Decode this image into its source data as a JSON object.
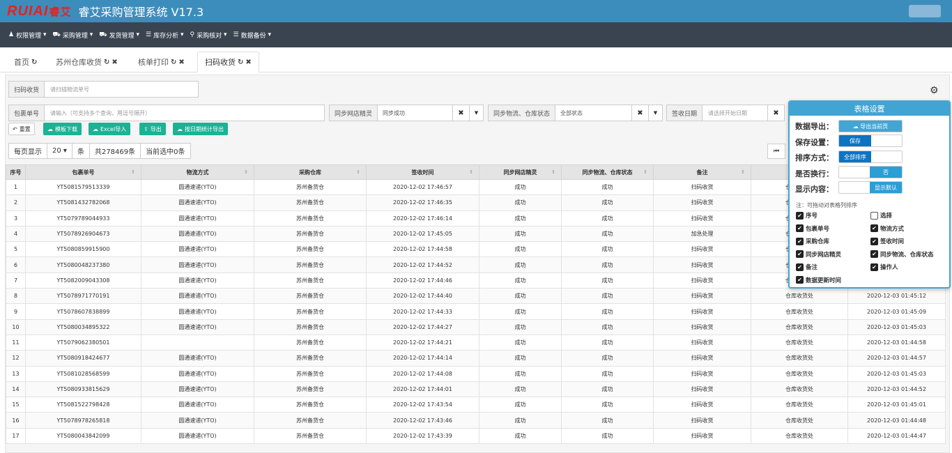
{
  "app": {
    "logo_text": "RUIAI",
    "logo_cn": "睿艾",
    "title": "睿艾采购管理系统 V17.3"
  },
  "menu": [
    {
      "icon": "user-icon",
      "glyph": "♟",
      "label": "权限管理"
    },
    {
      "icon": "cart-icon",
      "glyph": "⛟",
      "label": "采购管理"
    },
    {
      "icon": "truck-icon",
      "glyph": "⛟",
      "label": "发货管理"
    },
    {
      "icon": "list-icon",
      "glyph": "☰",
      "label": "库存分析"
    },
    {
      "icon": "search-icon",
      "glyph": "⚲",
      "label": "采购核对"
    },
    {
      "icon": "database-icon",
      "glyph": "☰",
      "label": "数据备份"
    }
  ],
  "tabs": [
    {
      "label": "首页"
    },
    {
      "label": "苏州仓库收货"
    },
    {
      "label": "核单打印"
    },
    {
      "label": "扫码收货"
    }
  ],
  "scan": {
    "label": "扫码收货",
    "placeholder": "请扫描物流单号"
  },
  "filters": {
    "package_label": "包裹单号",
    "package_placeholder": "请输入（可支持多个查询，用逗号隔开）",
    "sync_shop_label": "同步网店精灵",
    "sync_shop_value": "同步成功",
    "sync_status_label": "同步物流、仓库状态",
    "sync_status_value": "全部状态",
    "date_label": "签收日期",
    "date_placeholder": "请选择开始日期"
  },
  "toolbar": {
    "reset": "重置",
    "template_download": "模板下载",
    "excel_import": "Excel导入",
    "export": "导出",
    "export_by_date": "按日期统计导出"
  },
  "pagination": {
    "per_page_label": "每页显示",
    "per_page_value": "20",
    "unit": "条",
    "total": "共278469条",
    "selected": "当前选中0条"
  },
  "table": {
    "columns": [
      "序号",
      "包裹单号",
      "物流方式",
      "采购仓库",
      "签收时间",
      "同步网店精灵",
      "同步物流、仓库状态",
      "备注",
      "操作人",
      "数据更新时间"
    ],
    "rows": [
      [
        "1",
        "YT5081579513339",
        "圆通速递(YTO)",
        "苏州备货仓",
        "2020-12-02 17:46:57",
        "成功",
        "成功",
        "扫码收货",
        "仓库收货处",
        ""
      ],
      [
        "2",
        "YT5081432782068",
        "圆通速递(YTO)",
        "苏州备货仓",
        "2020-12-02 17:46:35",
        "成功",
        "成功",
        "扫码收货",
        "仓库收货处",
        ""
      ],
      [
        "3",
        "YT5079789044933",
        "圆通速递(YTO)",
        "苏州备货仓",
        "2020-12-02 17:46:14",
        "成功",
        "成功",
        "扫码收货",
        "仓库收货处",
        ""
      ],
      [
        "4",
        "YT5078926904673",
        "圆通速递(YTO)",
        "苏州备货仓",
        "2020-12-02 17:45:05",
        "成功",
        "成功",
        "加急处理",
        "仓库收货处",
        ""
      ],
      [
        "5",
        "YT5080859915900",
        "圆通速递(YTO)",
        "苏州备货仓",
        "2020-12-02 17:44:58",
        "成功",
        "成功",
        "扫码收货",
        "仓库收货处",
        ""
      ],
      [
        "6",
        "YT5080048237380",
        "圆通速递(YTO)",
        "苏州备货仓",
        "2020-12-02 17:44:52",
        "成功",
        "成功",
        "扫码收货",
        "仓库收货处",
        ""
      ],
      [
        "7",
        "YT5082009043308",
        "圆通速递(YTO)",
        "苏州备货仓",
        "2020-12-02 17:44:46",
        "成功",
        "成功",
        "扫码收货",
        "仓库收货处",
        ""
      ],
      [
        "8",
        "YT5078971770191",
        "圆通速递(YTO)",
        "苏州备货仓",
        "2020-12-02 17:44:40",
        "成功",
        "成功",
        "扫码收货",
        "仓库收货处",
        "2020-12-03 01:45:12"
      ],
      [
        "9",
        "YT5078607838899",
        "圆通速递(YTO)",
        "苏州备货仓",
        "2020-12-02 17:44:33",
        "成功",
        "成功",
        "扫码收货",
        "仓库收货处",
        "2020-12-03 01:45:09"
      ],
      [
        "10",
        "YT5080034895322",
        "圆通速递(YTO)",
        "苏州备货仓",
        "2020-12-02 17:44:27",
        "成功",
        "成功",
        "扫码收货",
        "仓库收货处",
        "2020-12-03 01:45:03"
      ],
      [
        "11",
        "YT5079062380501",
        "",
        "苏州备货仓",
        "2020-12-02 17:44:21",
        "成功",
        "成功",
        "扫码收货",
        "仓库收货处",
        "2020-12-03 01:44:58"
      ],
      [
        "12",
        "YT5080918424677",
        "圆通速递(YTO)",
        "苏州备货仓",
        "2020-12-02 17:44:14",
        "成功",
        "成功",
        "扫码收货",
        "仓库收货处",
        "2020-12-03 01:44:57"
      ],
      [
        "13",
        "YT5081028568599",
        "圆通速递(YTO)",
        "苏州备货仓",
        "2020-12-02 17:44:08",
        "成功",
        "成功",
        "扫码收货",
        "仓库收货处",
        "2020-12-03 01:45:03"
      ],
      [
        "14",
        "YT5080933815629",
        "圆通速递(YTO)",
        "苏州备货仓",
        "2020-12-02 17:44:01",
        "成功",
        "成功",
        "扫码收货",
        "仓库收货处",
        "2020-12-03 01:44:52"
      ],
      [
        "15",
        "YT5081522798428",
        "圆通速递(YTO)",
        "苏州备货仓",
        "2020-12-02 17:43:54",
        "成功",
        "成功",
        "扫码收货",
        "仓库收货处",
        "2020-12-03 01:45:01"
      ],
      [
        "16",
        "YT5078978265818",
        "圆通速递(YTO)",
        "苏州备货仓",
        "2020-12-02 17:43:46",
        "成功",
        "成功",
        "扫码收货",
        "仓库收货处",
        "2020-12-03 01:44:48"
      ],
      [
        "17",
        "YT5080043842099",
        "圆通速递(YTO)",
        "苏州备货仓",
        "2020-12-02 17:43:39",
        "成功",
        "成功",
        "扫码收货",
        "仓库收货处",
        "2020-12-03 01:44:47"
      ]
    ]
  },
  "settings": {
    "title": "表格设置",
    "export_label": "数据导出：",
    "export_btn": "导出当前页",
    "save_label": "保存设置：",
    "save_btn": "保存",
    "sort_label": "排序方式：",
    "sort_btn": "全部排序",
    "wrap_label": "是否换行：",
    "wrap_btn": "否",
    "display_label": "显示内容：",
    "display_btn": "显示默认",
    "note": "注：可拖动对表格列排序",
    "columns": [
      {
        "label": "序号",
        "checked": true
      },
      {
        "label": "选择",
        "checked": false
      },
      {
        "label": "包裹单号",
        "checked": true
      },
      {
        "label": "物流方式",
        "checked": true
      },
      {
        "label": "采购仓库",
        "checked": true
      },
      {
        "label": "签收时间",
        "checked": true
      },
      {
        "label": "同步网店精灵",
        "checked": true
      },
      {
        "label": "同步物流、仓库状态",
        "checked": true
      },
      {
        "label": "备注",
        "checked": true
      },
      {
        "label": "操作人",
        "checked": true
      },
      {
        "label": "数据更新时间",
        "checked": true
      }
    ]
  }
}
